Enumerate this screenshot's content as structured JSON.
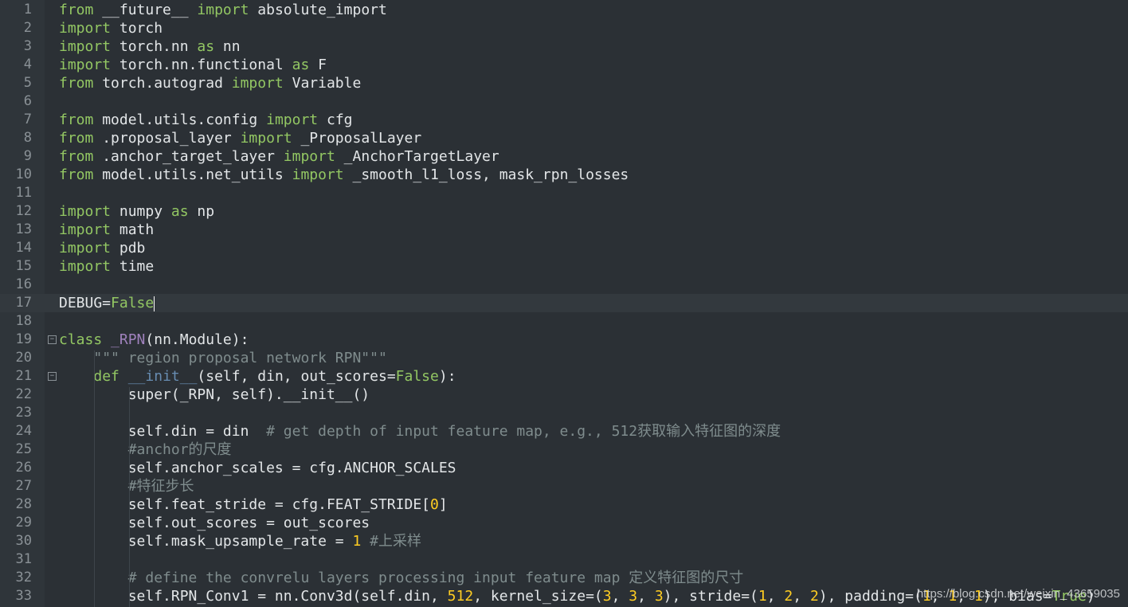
{
  "editor": {
    "lines": [
      {
        "n": "1",
        "tokens": [
          [
            "kw",
            "from"
          ],
          [
            "t",
            " __future__ "
          ],
          [
            "kw",
            "import"
          ],
          [
            "t",
            " absolute_import"
          ]
        ]
      },
      {
        "n": "2",
        "tokens": [
          [
            "kw",
            "import"
          ],
          [
            "t",
            " torch"
          ]
        ]
      },
      {
        "n": "3",
        "tokens": [
          [
            "kw",
            "import"
          ],
          [
            "t",
            " torch.nn "
          ],
          [
            "kw",
            "as"
          ],
          [
            "t",
            " nn"
          ]
        ]
      },
      {
        "n": "4",
        "tokens": [
          [
            "kw",
            "import"
          ],
          [
            "t",
            " torch.nn.functional "
          ],
          [
            "kw",
            "as"
          ],
          [
            "t",
            " F"
          ]
        ]
      },
      {
        "n": "5",
        "tokens": [
          [
            "kw",
            "from"
          ],
          [
            "t",
            " torch.autograd "
          ],
          [
            "kw",
            "import"
          ],
          [
            "t",
            " Variable"
          ]
        ]
      },
      {
        "n": "6",
        "tokens": []
      },
      {
        "n": "7",
        "tokens": [
          [
            "kw",
            "from"
          ],
          [
            "t",
            " model.utils.config "
          ],
          [
            "kw",
            "import"
          ],
          [
            "t",
            " cfg"
          ]
        ]
      },
      {
        "n": "8",
        "tokens": [
          [
            "kw",
            "from"
          ],
          [
            "t",
            " .proposal_layer "
          ],
          [
            "kw",
            "import"
          ],
          [
            "t",
            " _ProposalLayer"
          ]
        ]
      },
      {
        "n": "9",
        "tokens": [
          [
            "kw",
            "from"
          ],
          [
            "t",
            " .anchor_target_layer "
          ],
          [
            "kw",
            "import"
          ],
          [
            "t",
            " _AnchorTargetLayer"
          ]
        ]
      },
      {
        "n": "10",
        "tokens": [
          [
            "kw",
            "from"
          ],
          [
            "t",
            " model.utils.net_utils "
          ],
          [
            "kw",
            "import"
          ],
          [
            "t",
            " _smooth_l1_loss, mask_rpn_losses"
          ]
        ]
      },
      {
        "n": "11",
        "tokens": []
      },
      {
        "n": "12",
        "tokens": [
          [
            "kw",
            "import"
          ],
          [
            "t",
            " numpy "
          ],
          [
            "kw",
            "as"
          ],
          [
            "t",
            " np"
          ]
        ]
      },
      {
        "n": "13",
        "tokens": [
          [
            "kw",
            "import"
          ],
          [
            "t",
            " math"
          ]
        ]
      },
      {
        "n": "14",
        "tokens": [
          [
            "kw",
            "import"
          ],
          [
            "t",
            " pdb"
          ]
        ]
      },
      {
        "n": "15",
        "tokens": [
          [
            "kw",
            "import"
          ],
          [
            "t",
            " time"
          ]
        ]
      },
      {
        "n": "16",
        "tokens": []
      },
      {
        "n": "17",
        "tokens": [
          [
            "t",
            "DEBUG="
          ],
          [
            "bool",
            "False"
          ]
        ],
        "current": true
      },
      {
        "n": "18",
        "tokens": []
      },
      {
        "n": "19",
        "tokens": [
          [
            "kw",
            "class"
          ],
          [
            "t",
            " "
          ],
          [
            "cls",
            "_RPN"
          ],
          [
            "t",
            "(nn.Module):"
          ]
        ],
        "fold": true
      },
      {
        "n": "20",
        "tokens": [
          [
            "t",
            "    "
          ],
          [
            "str",
            "\"\"\" region proposal network RPN\"\"\""
          ]
        ]
      },
      {
        "n": "21",
        "tokens": [
          [
            "t",
            "    "
          ],
          [
            "kw",
            "def"
          ],
          [
            "t",
            " "
          ],
          [
            "fn",
            "__init__"
          ],
          [
            "t",
            "(self, din, out_scores="
          ],
          [
            "bool",
            "False"
          ],
          [
            "t",
            "):"
          ]
        ],
        "fold": true
      },
      {
        "n": "22",
        "tokens": [
          [
            "t",
            "        super(_RPN, self).__init__()"
          ]
        ]
      },
      {
        "n": "23",
        "tokens": []
      },
      {
        "n": "24",
        "tokens": [
          [
            "t",
            "        self.din = din  "
          ],
          [
            "cmt",
            "# get depth of input feature map, e.g., 512获取输入特征图的深度"
          ]
        ]
      },
      {
        "n": "25",
        "tokens": [
          [
            "t",
            "        "
          ],
          [
            "cmt",
            "#anchor的尺度"
          ]
        ]
      },
      {
        "n": "26",
        "tokens": [
          [
            "t",
            "        self.anchor_scales = cfg.ANCHOR_SCALES"
          ]
        ]
      },
      {
        "n": "27",
        "tokens": [
          [
            "t",
            "        "
          ],
          [
            "cmt",
            "#特征步长"
          ]
        ]
      },
      {
        "n": "28",
        "tokens": [
          [
            "t",
            "        self.feat_stride = cfg.FEAT_STRIDE["
          ],
          [
            "num",
            "0"
          ],
          [
            "t",
            "]"
          ]
        ]
      },
      {
        "n": "29",
        "tokens": [
          [
            "t",
            "        self.out_scores = out_scores"
          ]
        ]
      },
      {
        "n": "30",
        "tokens": [
          [
            "t",
            "        self.mask_upsample_rate = "
          ],
          [
            "num",
            "1"
          ],
          [
            "t",
            " "
          ],
          [
            "cmt",
            "#上采样"
          ]
        ]
      },
      {
        "n": "31",
        "tokens": []
      },
      {
        "n": "32",
        "tokens": [
          [
            "t",
            "        "
          ],
          [
            "cmt",
            "# define the convrelu layers processing input feature map 定义特征图的尺寸"
          ]
        ]
      },
      {
        "n": "33",
        "tokens": [
          [
            "t",
            "        self.RPN_Conv1 = nn.Conv3d(self.din, "
          ],
          [
            "num",
            "512"
          ],
          [
            "t",
            ", kernel_size=("
          ],
          [
            "num",
            "3"
          ],
          [
            "t",
            ", "
          ],
          [
            "num",
            "3"
          ],
          [
            "t",
            ", "
          ],
          [
            "num",
            "3"
          ],
          [
            "t",
            "), stride=("
          ],
          [
            "num",
            "1"
          ],
          [
            "t",
            ", "
          ],
          [
            "num",
            "2"
          ],
          [
            "t",
            ", "
          ],
          [
            "num",
            "2"
          ],
          [
            "t",
            "), padding=("
          ],
          [
            "num",
            "1"
          ],
          [
            "t",
            ", "
          ],
          [
            "num",
            "1"
          ],
          [
            "t",
            ", "
          ],
          [
            "num",
            "1"
          ],
          [
            "t",
            "), bias="
          ],
          [
            "bool",
            "True"
          ],
          [
            "t",
            ")"
          ]
        ]
      }
    ]
  },
  "watermark": "https://blog.csdn.net/weixin_43659035",
  "colors": {
    "background": "#2b3035",
    "keyword": "#93c763",
    "comment": "#7f8c8d",
    "number": "#ffcd22",
    "class_name": "#a082bd",
    "function_name": "#678cb1",
    "text": "#e3e6e8"
  }
}
